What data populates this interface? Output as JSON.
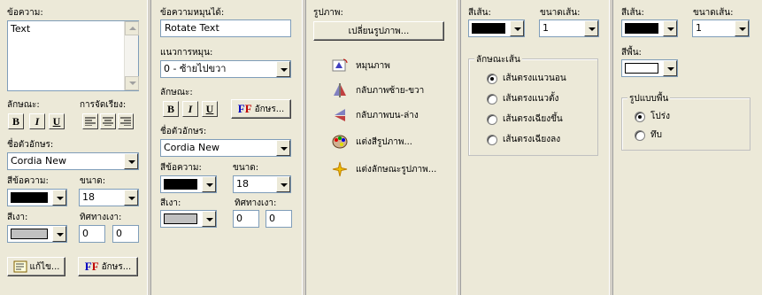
{
  "panel1": {
    "message_label": "ข้อความ:",
    "message_value": "Text",
    "style_label": "ลักษณะ:",
    "align_label": "การจัดเรียง:",
    "bold": "B",
    "italic": "I",
    "underline": "U",
    "fontname_label": "ชื่อตัวอักษร:",
    "fontname_value": "Cordia New",
    "textcolor_label": "สีข้อความ:",
    "size_label": "ขนาด:",
    "size_value": "18",
    "shadow_label": "สีเงา:",
    "shadowdir_label": "ทิศทางเงา:",
    "shadow_x": "0",
    "shadow_y": "0",
    "edit_button": "แก้ไข...",
    "font_button": "อักษร...",
    "colors": {
      "text": "#000000",
      "shadow": "#c0c0c0"
    }
  },
  "panel2": {
    "rotate_label": "ข้อความหมุนได้:",
    "rotate_value": "Rotate Text",
    "direction_label": "แนวการหมุน:",
    "direction_value": "0 - ซ้ายไปขวา",
    "style_label": "ลักษณะ:",
    "bold": "B",
    "italic": "I",
    "underline": "U",
    "font_button": "อักษร...",
    "fontname_label": "ชื่อตัวอักษร:",
    "fontname_value": "Cordia New",
    "textcolor_label": "สีข้อความ:",
    "size_label": "ขนาด:",
    "size_value": "18",
    "shadow_label": "สีเงา:",
    "shadowdir_label": "ทิศทางเงา:",
    "shadow_x": "0",
    "shadow_y": "0",
    "colors": {
      "text": "#000000",
      "shadow": "#c0c0c0"
    }
  },
  "panel3": {
    "image_label": "รูปภาพ:",
    "change_button": "เปลี่ยนรูปภาพ...",
    "actions": [
      {
        "label": "หมุนภาพ",
        "icon": "rotate-image-icon"
      },
      {
        "label": "กลับภาพซ้าย-ขวา",
        "icon": "flip-horizontal-icon"
      },
      {
        "label": "กลับภาพบน-ล่าง",
        "icon": "flip-vertical-icon"
      },
      {
        "label": "แต่งสีรูปภาพ...",
        "icon": "palette-icon"
      },
      {
        "label": "แต่งลักษณะรูปภาพ...",
        "icon": "sparkle-icon"
      }
    ]
  },
  "panel4": {
    "linecolor_label": "สีเส้น:",
    "linesize_label": "ขนาดเส้น:",
    "linesize_value": "1",
    "linestyle_group": "ลักษณะเส้น",
    "options": [
      {
        "label": "เส้นตรงแนวนอน",
        "checked": true
      },
      {
        "label": "เส้นตรงแนวตั้ง",
        "checked": false
      },
      {
        "label": "เส้นตรงเฉียงขึ้น",
        "checked": false
      },
      {
        "label": "เส้นตรงเฉียงลง",
        "checked": false
      }
    ],
    "colors": {
      "line": "#000000"
    }
  },
  "panel5": {
    "linecolor_label": "สีเส้น:",
    "linesize_label": "ขนาดเส้น:",
    "linesize_value": "1",
    "fill_label": "สีพื้น:",
    "bgstyle_group": "รูปแบบพื้น",
    "options": [
      {
        "label": "โปร่ง",
        "checked": true
      },
      {
        "label": "ทึบ",
        "checked": false
      }
    ],
    "colors": {
      "line": "#000000",
      "fill": "#ffffff"
    }
  }
}
